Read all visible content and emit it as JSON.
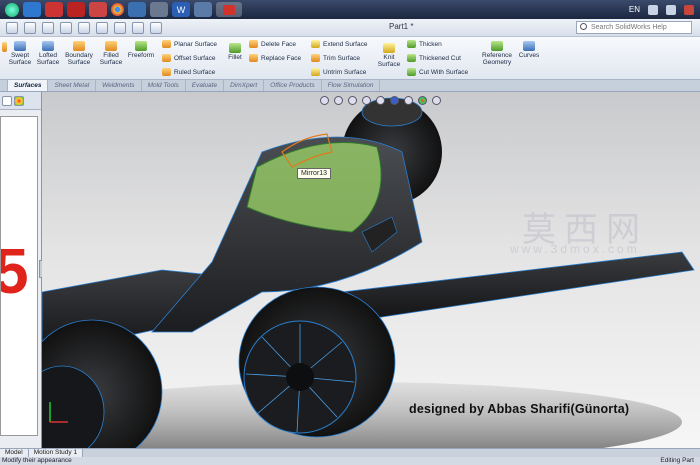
{
  "taskbar": {
    "language": "EN"
  },
  "titlebar": {
    "document_title": "Part1 *",
    "help_search_placeholder": "Search SolidWorks Help"
  },
  "ribbon": {
    "big_buttons": [
      {
        "label": "Swept Surface"
      },
      {
        "label": "Lofted Surface"
      },
      {
        "label": "Boundary Surface"
      },
      {
        "label": "Filled Surface"
      },
      {
        "label": "Freeform"
      }
    ],
    "group1": [
      "Planar Surface",
      "Offset Surface",
      "Ruled Surface"
    ],
    "fillet": "Fillet",
    "group2": [
      "Delete Face",
      "Replace Face"
    ],
    "group3": [
      "Extend Surface",
      "Trim Surface",
      "Untrim Surface"
    ],
    "knit": "Knit Surface",
    "group4": [
      "Thicken",
      "Thickened Cut",
      "Cut With Surface"
    ],
    "reference_geometry": "Reference Geometry",
    "curves": "Curves"
  },
  "tabs": [
    "Surfaces",
    "Sheet Metal",
    "Weldments",
    "Mold Tools",
    "Evaluate",
    "DimXpert",
    "Office Products",
    "Flow Simulation"
  ],
  "viewport": {
    "tooltip": "Mirror13",
    "watermark_cn": "莫西网",
    "watermark_url": "www.3dmox.com",
    "credit": "designed  by Abbas Sharifi(Günorta)"
  },
  "bottom_tabs": [
    "Model",
    "Motion Study 1"
  ],
  "status": {
    "left": "Modify their appearance",
    "right": "Editing Part"
  },
  "colors": {
    "selection_green": "#9fd86a",
    "edge_blue": "#3a8fd8",
    "accent_red": "#e0241b"
  }
}
